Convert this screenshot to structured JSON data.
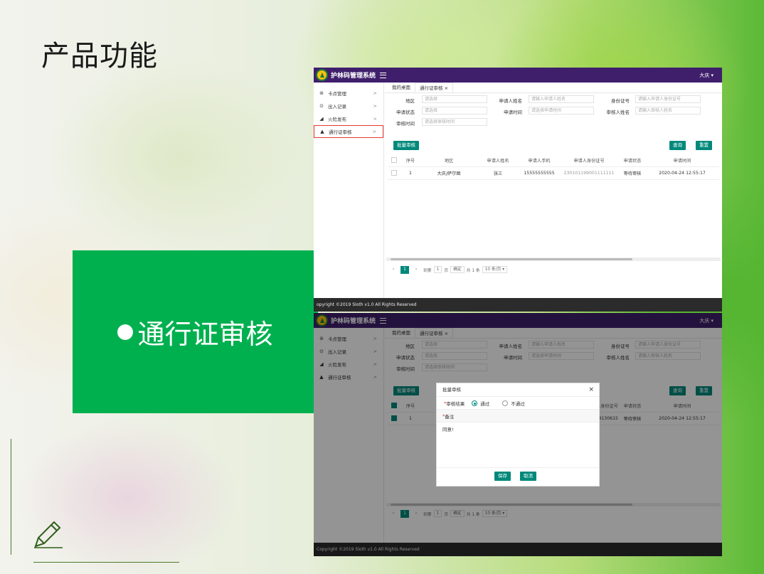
{
  "slide": {
    "title": "产品功能",
    "feature_label": "通行证审核",
    "pencil_icon": "pencil-icon"
  },
  "app": {
    "system_name": "护林码管理系统",
    "user_menu": "大庆 ▾",
    "footer": "Copyright ©2019 Sloth v1.0 All Rights Reserved",
    "footer_cropped": "opyright ©2019 Sloth v1.0 All Rights Reserved",
    "sidebar": [
      {
        "label": "卡点管理",
        "icon": "⊜"
      },
      {
        "label": "出入记录",
        "icon": "⊙"
      },
      {
        "label": "火险发布",
        "icon": "◢"
      },
      {
        "label": "通行证审核",
        "icon": "▲"
      }
    ],
    "tabs": [
      "我的桌面",
      "通行证审核"
    ],
    "filters": {
      "region_label": "地区",
      "region_placeholder": "请选择",
      "name_label": "申请人姓名",
      "name_placeholder": "请输入申请人姓名",
      "id_label": "身份证号",
      "id_placeholder": "请输入申请人身份证号",
      "status_label": "申请状态",
      "status_placeholder": "请选择",
      "apply_time_label": "申请时间",
      "apply_time_placeholder": "请选择申请时间",
      "reviewer_label": "审核人姓名",
      "reviewer_placeholder": "请输入审核人姓名",
      "review_time_label": "审核时间",
      "review_time_placeholder": "请选择审核时间"
    },
    "buttons": {
      "batch_review": "批量审核",
      "query": "查询",
      "reset": "重置"
    },
    "table": {
      "headers": [
        "序号",
        "地区",
        "申请人姓名",
        "申请人手机",
        "申请人身份证号",
        "申请状态",
        "申请时间"
      ],
      "row": {
        "index": "1",
        "region": "大庆/萨尔图",
        "name": "张三",
        "phone": "15555555555",
        "id_number": "230101199001111111",
        "id_number_partial": "4130615",
        "status": "等待审核",
        "time": "2020-04-24 12:55:17"
      }
    },
    "pager": {
      "page": "1",
      "goto": "到第",
      "goto_value": "1",
      "page_unit": "页",
      "confirm": "确定",
      "total": "共 1 条",
      "per_page": "10 条/页 ▾"
    },
    "modal": {
      "title": "批量审核",
      "result_label": "审核结果",
      "pass": "通过",
      "reject": "不通过",
      "remark_label": "备注",
      "remark_value": "同意!",
      "save": "保存",
      "cancel": "取消"
    }
  }
}
